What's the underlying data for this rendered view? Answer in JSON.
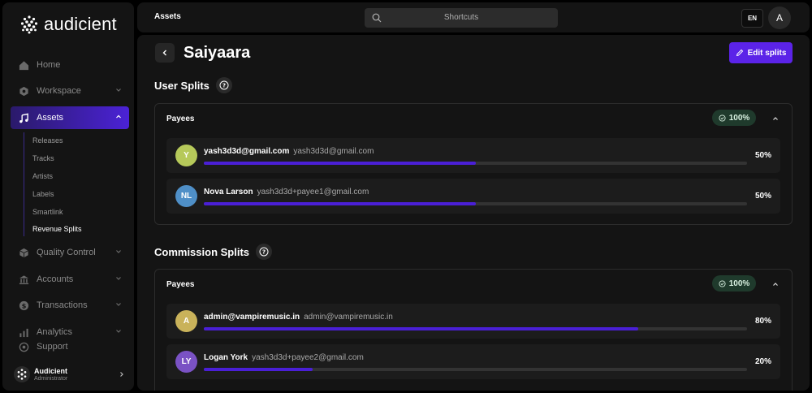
{
  "app": {
    "name": "audicient"
  },
  "sidebar": {
    "items": [
      {
        "label": "Home",
        "icon": "home-icon",
        "has_chevron": false
      },
      {
        "label": "Workspace",
        "icon": "hexagon-icon",
        "has_chevron": true
      },
      {
        "label": "Assets",
        "icon": "music-note-icon",
        "has_chevron": true,
        "active": true
      },
      {
        "label": "Quality Control",
        "icon": "cube-icon",
        "has_chevron": true
      },
      {
        "label": "Accounts",
        "icon": "bank-icon",
        "has_chevron": true
      },
      {
        "label": "Transactions",
        "icon": "dollar-icon",
        "has_chevron": true
      },
      {
        "label": "Analytics",
        "icon": "chart-icon",
        "has_chevron": true
      },
      {
        "label": "Support",
        "icon": "support-icon",
        "has_chevron": false
      }
    ],
    "sub_items": [
      "Releases",
      "Tracks",
      "Artists",
      "Labels",
      "Smartlink",
      "Revenue Splits"
    ],
    "user": {
      "name": "Audicient",
      "role": "Administrator"
    }
  },
  "topbar": {
    "title": "Assets",
    "search_placeholder": "Shortcuts",
    "language": "EN",
    "avatar_initial": "A"
  },
  "page": {
    "title": "Saiyaara",
    "edit_label": "Edit splits"
  },
  "user_splits": {
    "title": "User Splits",
    "header": "Payees",
    "total": "100%",
    "payees": [
      {
        "initials": "Y",
        "name": "yash3d3d@gmail.com",
        "email": "yash3d3d@gmail.com",
        "percent": "50%",
        "share": 50,
        "color": "#b6c95a"
      },
      {
        "initials": "NL",
        "name": "Nova Larson",
        "email": "yash3d3d+payee1@gmail.com",
        "percent": "50%",
        "share": 50,
        "color": "#4f8fc7"
      }
    ]
  },
  "commission_splits": {
    "title": "Commission Splits",
    "header": "Payees",
    "total": "100%",
    "payees": [
      {
        "initials": "A",
        "name": "admin@vampiremusic.in",
        "email": "admin@vampiremusic.in",
        "percent": "80%",
        "share": 80,
        "color": "#c9b25a"
      },
      {
        "initials": "LY",
        "name": "Logan York",
        "email": "yash3d3d+payee2@gmail.com",
        "percent": "20%",
        "share": 20,
        "color": "#7a52c4"
      }
    ]
  },
  "colors": {
    "accent": "#5b23e8",
    "bar": "#4a1fd6",
    "badge": "#1f3a2c"
  }
}
